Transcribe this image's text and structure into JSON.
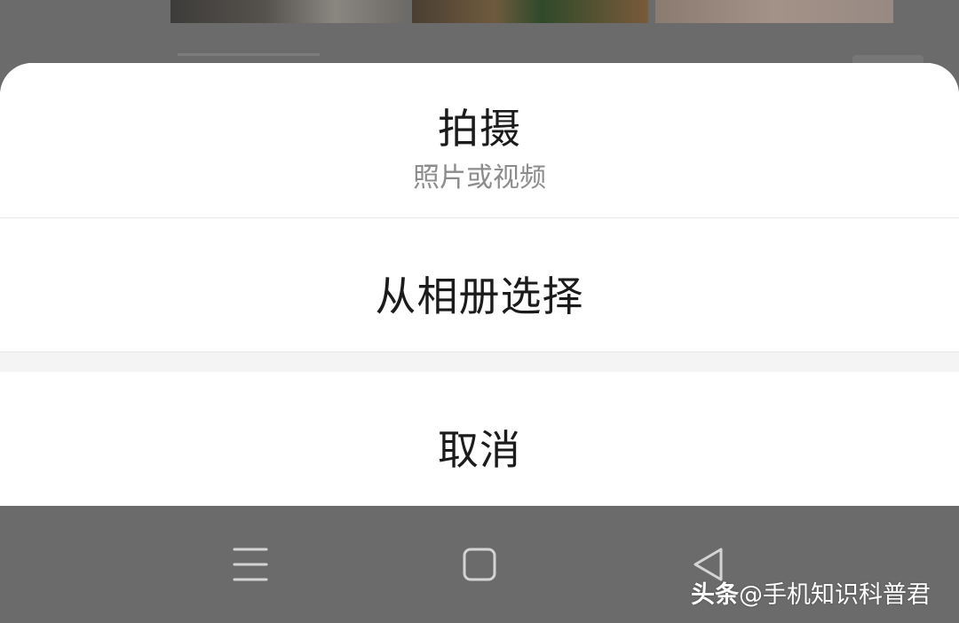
{
  "action_sheet": {
    "capture": {
      "title": "拍摄",
      "subtitle": "照片或视频"
    },
    "choose_from_album": "从相册选择",
    "cancel": "取消"
  },
  "navigation_bar": {
    "menu_icon": "menu-icon",
    "home_icon": "home-icon",
    "back_icon": "back-icon"
  },
  "watermark": {
    "brand": "头条",
    "account": "@手机知识科普君"
  },
  "colors": {
    "sheet_background": "#ffffff",
    "overlay": "#6b6b6b",
    "primary_text": "#1b1b1b",
    "secondary_text": "#8c8c8c",
    "divider": "#e6e6e6",
    "nav_icon": "#d4d4d4"
  }
}
